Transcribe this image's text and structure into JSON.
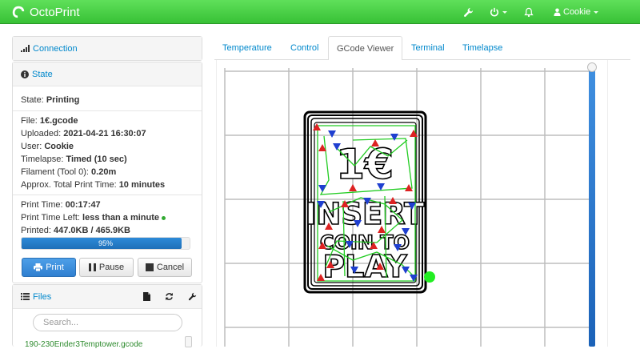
{
  "navbar": {
    "brand": "OctoPrint",
    "user": "Cookie",
    "icons": [
      "wrench-icon",
      "power-icon",
      "bell-icon",
      "user-icon"
    ]
  },
  "connection": {
    "title": "Connection"
  },
  "state": {
    "title": "State",
    "state_label": "State:",
    "state_value": "Printing",
    "file_label": "File:",
    "file_value": "1€.gcode",
    "uploaded_label": "Uploaded:",
    "uploaded_value": "2021-04-21 16:30:07",
    "user_label": "User:",
    "user_value": "Cookie",
    "timelapse_label": "Timelapse:",
    "timelapse_value": "Timed (10 sec)",
    "filament_label": "Filament (Tool 0):",
    "filament_value": "0.20m",
    "approx_label": "Approx. Total Print Time:",
    "approx_value": "10 minutes",
    "print_time_label": "Print Time:",
    "print_time_value": "00:17:47",
    "time_left_label": "Print Time Left:",
    "time_left_value": "less than a minute",
    "printed_label": "Printed:",
    "printed_value": "447.0KB / 465.9KB",
    "progress_text": "95%",
    "progress_fraction": 0.95
  },
  "controls": {
    "print": "Print",
    "pause": "Pause",
    "cancel": "Cancel"
  },
  "files": {
    "title": "Files",
    "search_placeholder": "Search...",
    "first_file": "190-230Ender3Temptower.gcode"
  },
  "tabs": [
    "Temperature",
    "Control",
    "GCode Viewer",
    "Terminal",
    "Timelapse"
  ],
  "active_tab": "GCode Viewer",
  "viewer": {
    "text_lines": [
      "1€",
      "INSERT",
      "COIN TO",
      "PLAY"
    ],
    "colors": {
      "grid": "#bdbdbd",
      "outline": "#000000",
      "travel": "#22cc22",
      "start": "#dd2222",
      "end": "#1f3fd0",
      "head": "#22ee22"
    }
  },
  "colors": {
    "navbar": "#3fc63c",
    "link": "#0088cc",
    "progress": "#2a7fd0",
    "slider": "#2a78d4"
  }
}
